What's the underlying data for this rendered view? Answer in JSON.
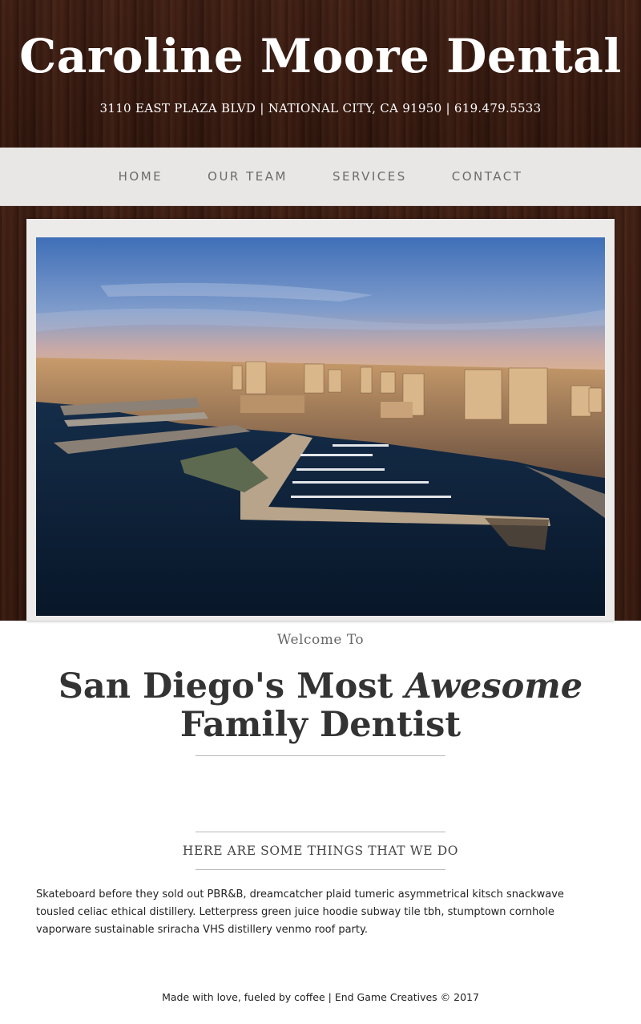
{
  "header": {
    "title": "Caroline Moore Dental",
    "address": "3110 EAST PLAZA BLVD | NATIONAL CITY, CA 91950 | 619.479.5533"
  },
  "nav": {
    "items": [
      {
        "label": "HOME"
      },
      {
        "label": "OUR TEAM"
      },
      {
        "label": "SERVICES"
      },
      {
        "label": "CONTACT"
      }
    ]
  },
  "intro": {
    "welcome": "Welcome To",
    "headline_part1": "San Diego's Most ",
    "headline_emphasis": "Awesome",
    "headline_part2": "Family Dentist"
  },
  "services": {
    "heading": "HERE ARE SOME THINGS THAT WE DO",
    "body": "Skateboard before they sold out PBR&B, dreamcatcher plaid tumeric asymmetrical kitsch snackwave tousled celiac ethical distillery. Letterpress green juice hoodie subway tile tbh, stumptown cornhole vaporware sustainable sriracha VHS distillery venmo roof party."
  },
  "footer": {
    "text": "Made with love, fueled by coffee | End Game Creatives © 2017"
  }
}
